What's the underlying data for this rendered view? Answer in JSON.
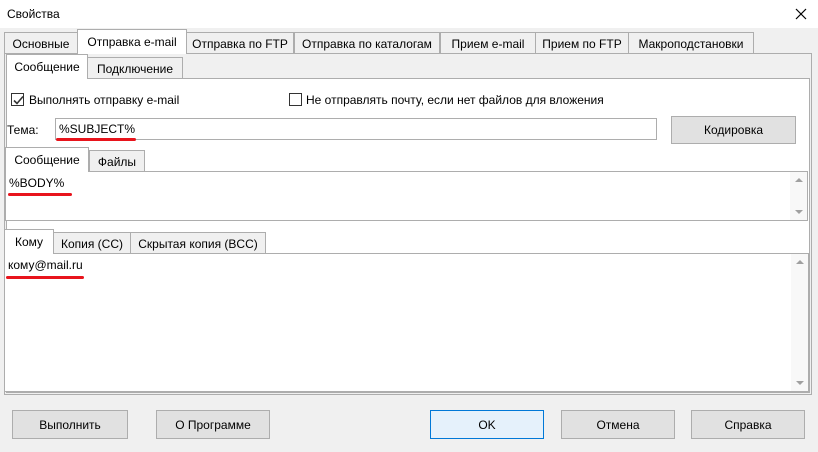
{
  "window": {
    "title": "Свойства",
    "close_icon": "close-icon"
  },
  "main_tabs": [
    {
      "label": "Основные",
      "active": false
    },
    {
      "label": "Отправка e-mail",
      "active": true
    },
    {
      "label": "Отправка по FTP",
      "active": false
    },
    {
      "label": "Отправка по каталогам",
      "active": false
    },
    {
      "label": "Прием e-mail",
      "active": false
    },
    {
      "label": "Прием по FTP",
      "active": false
    },
    {
      "label": "Макроподстановки",
      "active": false
    }
  ],
  "sub_tabs": [
    {
      "label": "Сообщение",
      "active": true
    },
    {
      "label": "Подключение",
      "active": false
    }
  ],
  "options": {
    "send_email_label": "Выполнять отправку e-mail",
    "send_email_checked": true,
    "no_attach_label": "Не отправлять почту, если нет файлов для вложения",
    "no_attach_checked": false
  },
  "subject": {
    "label": "Тема:",
    "value": "%SUBJECT%",
    "encoding_button": "Кодировка"
  },
  "body_tabs": [
    {
      "label": "Сообщение",
      "active": true
    },
    {
      "label": "Файлы",
      "active": false
    }
  ],
  "body": {
    "value": "%BODY%"
  },
  "recipient_tabs": [
    {
      "label": "Кому",
      "active": true
    },
    {
      "label": "Копия (CC)",
      "active": false
    },
    {
      "label": "Скрытая копия (BCC)",
      "active": false
    }
  ],
  "recipients": {
    "value": "кому@mail.ru"
  },
  "footer": {
    "run": "Выполнить",
    "about": "О Программе",
    "ok": "OK",
    "cancel": "Отмена",
    "help": "Справка"
  },
  "colors": {
    "highlight_underline": "#e8141c",
    "default_button_border": "#0078d7"
  }
}
